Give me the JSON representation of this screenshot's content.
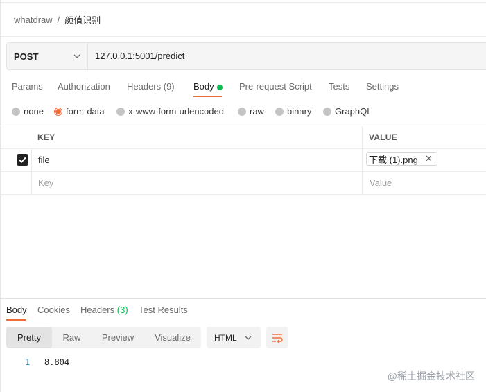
{
  "breadcrumb": {
    "workspace": "whatdraw",
    "separator": "/",
    "request_name": "颜值识别"
  },
  "request": {
    "method": "POST",
    "url": "127.0.0.1:5001/predict"
  },
  "request_tabs": {
    "params": "Params",
    "authorization": "Authorization",
    "headers": "Headers (9)",
    "body": "Body",
    "pre_request_script": "Pre-request Script",
    "tests": "Tests",
    "settings": "Settings"
  },
  "body_types": {
    "none": "none",
    "form_data": "form-data",
    "urlencoded": "x-www-form-urlencoded",
    "raw": "raw",
    "binary": "binary",
    "graphql": "GraphQL",
    "selected": "form-data"
  },
  "form_table": {
    "key_header": "KEY",
    "value_header": "VALUE",
    "row_key": "file",
    "row_value": "下载 (1).png",
    "key_placeholder": "Key",
    "value_placeholder": "Value"
  },
  "response_tabs": {
    "body": "Body",
    "cookies": "Cookies",
    "headers": "Headers",
    "headers_count": "(3)",
    "test_results": "Test Results"
  },
  "response_view": {
    "pretty": "Pretty",
    "raw": "Raw",
    "preview": "Preview",
    "visualize": "Visualize",
    "format": "HTML"
  },
  "response_body": {
    "line_number": "1",
    "content": "8.804"
  },
  "watermark": "@稀土掘金技术社区",
  "colors": {
    "accent": "#f26b3a",
    "active_dot": "#0cbb52",
    "line_number": "#2f8fb5"
  }
}
